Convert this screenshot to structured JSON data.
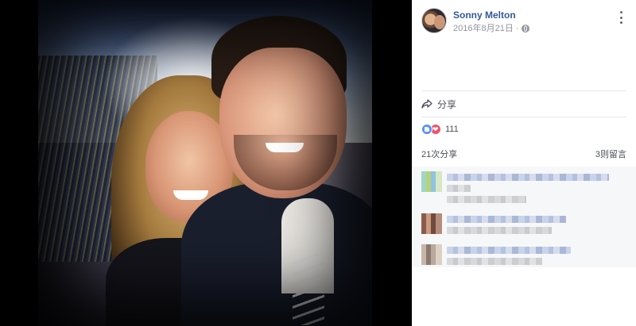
{
  "post": {
    "author": "Sonny Melton",
    "date": "2016年8月21日",
    "separator": "·",
    "privacy_icon": "globe-icon",
    "more_icon": "more-vertical-icon"
  },
  "actions": {
    "share_label": "分享",
    "share_icon": "share-arrow-icon"
  },
  "reactions": {
    "icons": [
      "like-icon",
      "love-icon"
    ],
    "count": "111"
  },
  "stats": {
    "shares": "21次分享",
    "comments": "3则留言"
  },
  "colors": {
    "link_blue": "#365899",
    "like_blue": "#5890ff",
    "love_red": "#f25268",
    "meta_grey": "#90949c"
  }
}
